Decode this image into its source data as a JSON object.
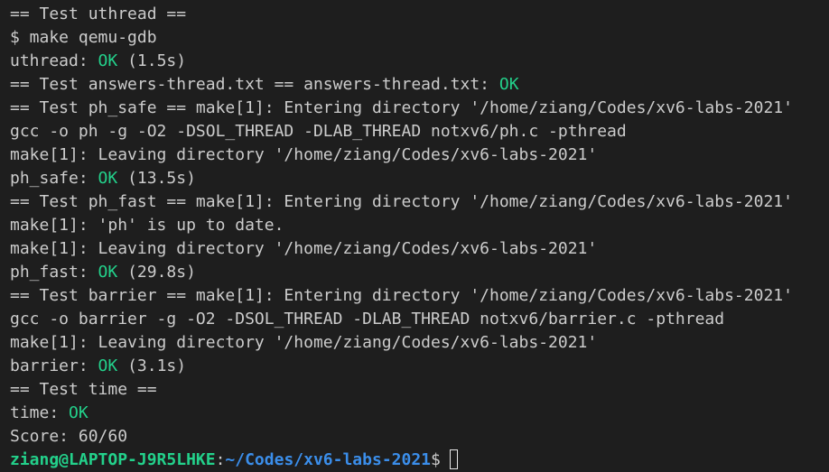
{
  "terminal": {
    "lines": [
      {
        "text": "== Test uthread =="
      },
      {
        "text": "$ make qemu-gdb"
      },
      {
        "text": "uthread: ",
        "ok": "OK",
        "suffix": " (1.5s)"
      },
      {
        "text": "== Test answers-thread.txt == answers-thread.txt: ",
        "ok": "OK",
        "suffix": ""
      },
      {
        "text": "== Test ph_safe == make[1]: Entering directory '/home/ziang/Codes/xv6-labs-2021'"
      },
      {
        "text": "gcc -o ph -g -O2 -DSOL_THREAD -DLAB_THREAD notxv6/ph.c -pthread"
      },
      {
        "text": "make[1]: Leaving directory '/home/ziang/Codes/xv6-labs-2021'"
      },
      {
        "text": "ph_safe: ",
        "ok": "OK",
        "suffix": " (13.5s)"
      },
      {
        "text": "== Test ph_fast == make[1]: Entering directory '/home/ziang/Codes/xv6-labs-2021'"
      },
      {
        "text": "make[1]: 'ph' is up to date."
      },
      {
        "text": "make[1]: Leaving directory '/home/ziang/Codes/xv6-labs-2021'"
      },
      {
        "text": "ph_fast: ",
        "ok": "OK",
        "suffix": " (29.8s)"
      },
      {
        "text": "== Test barrier == make[1]: Entering directory '/home/ziang/Codes/xv6-labs-2021'"
      },
      {
        "text": "gcc -o barrier -g -O2 -DSOL_THREAD -DLAB_THREAD notxv6/barrier.c -pthread"
      },
      {
        "text": "make[1]: Leaving directory '/home/ziang/Codes/xv6-labs-2021'"
      },
      {
        "text": "barrier: ",
        "ok": "OK",
        "suffix": " (3.1s)"
      },
      {
        "text": "== Test time =="
      },
      {
        "text": "time: ",
        "ok": "OK",
        "suffix": ""
      },
      {
        "text": "Score: 60/60"
      }
    ],
    "prompt": {
      "user_host": "ziang@LAPTOP-J9R5LHKE",
      "separator": ":",
      "path": "~/Codes/xv6-labs-2021",
      "symbol": "$"
    }
  },
  "colors": {
    "background": "#1e1e1e",
    "foreground": "#cccccc",
    "ok": "#23d18b",
    "prompt_user": "#23d18b",
    "prompt_path": "#3b8eea"
  }
}
